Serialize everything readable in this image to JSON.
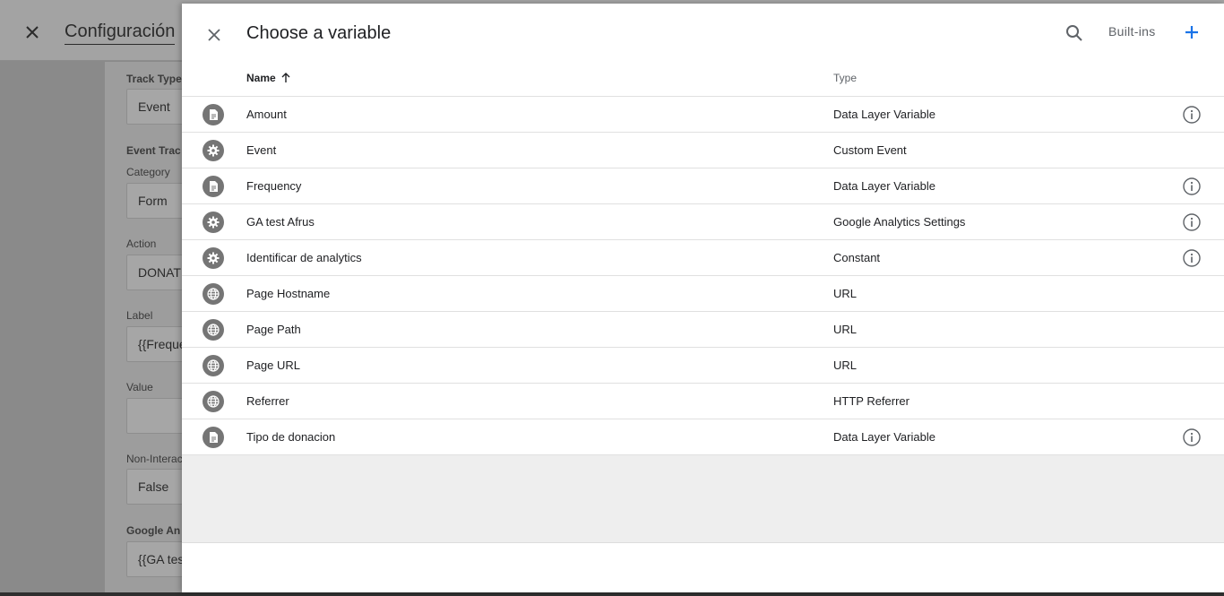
{
  "background": {
    "title": "Configuración",
    "fields": [
      {
        "label": "Track Type",
        "value": "Event"
      },
      {
        "label": "Event Trac",
        "value": ""
      },
      {
        "label": "Category",
        "value": "Form"
      },
      {
        "label": "Action",
        "value": "DONATI"
      },
      {
        "label": "Label",
        "value": "{{Freque"
      },
      {
        "label": "Value",
        "value": ""
      },
      {
        "label": "Non-Interac",
        "value": "False"
      },
      {
        "label": "Google An",
        "value": "{{GA tes"
      }
    ]
  },
  "panel": {
    "title": "Choose a variable",
    "builtins_label": "Built-ins",
    "columns": {
      "name": "Name",
      "type": "Type"
    },
    "rows": [
      {
        "name": "Amount",
        "type": "Data Layer Variable",
        "icon": "doc-icon",
        "info": true
      },
      {
        "name": "Event",
        "type": "Custom Event",
        "icon": "gear-icon",
        "info": false
      },
      {
        "name": "Frequency",
        "type": "Data Layer Variable",
        "icon": "doc-icon",
        "info": true
      },
      {
        "name": "GA test Afrus",
        "type": "Google Analytics Settings",
        "icon": "gear-icon",
        "info": true
      },
      {
        "name": "Identificar de analytics",
        "type": "Constant",
        "icon": "gear-icon",
        "info": true
      },
      {
        "name": "Page Hostname",
        "type": "URL",
        "icon": "globe-icon",
        "info": false
      },
      {
        "name": "Page Path",
        "type": "URL",
        "icon": "globe-icon",
        "info": false
      },
      {
        "name": "Page URL",
        "type": "URL",
        "icon": "globe-icon",
        "info": false
      },
      {
        "name": "Referrer",
        "type": "HTTP Referrer",
        "icon": "globe-icon",
        "info": false
      },
      {
        "name": "Tipo de donacion",
        "type": "Data Layer Variable",
        "icon": "doc-icon",
        "info": true
      }
    ]
  },
  "colors": {
    "accent": "#1a73e8",
    "icon_bg": "#757575"
  }
}
